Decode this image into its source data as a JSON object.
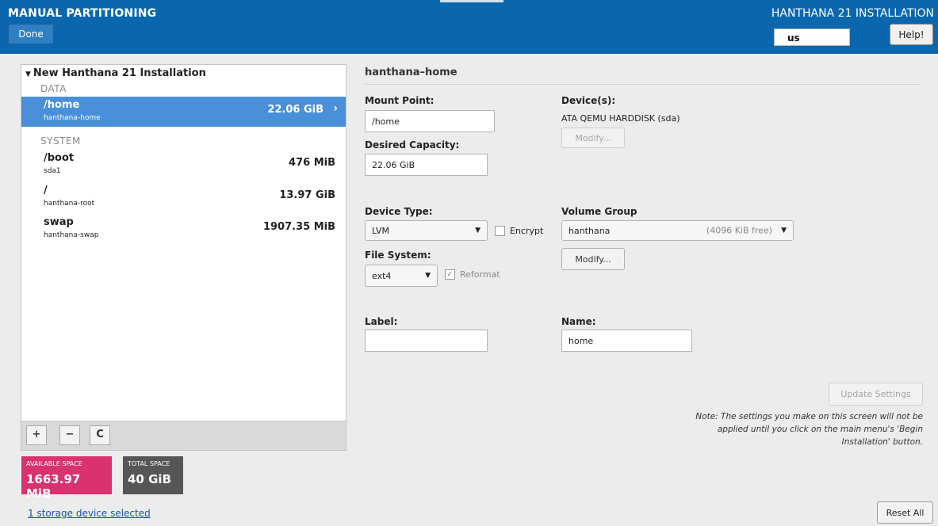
{
  "header": {
    "title": "MANUAL PARTITIONING",
    "installer_title": "HANTHANA 21 INSTALLATION",
    "done_label": "Done",
    "keyboard_layout": "us",
    "help_label": "Help!"
  },
  "tree": {
    "title": "New Hanthana 21 Installation",
    "groups": [
      {
        "label": "DATA",
        "partitions": [
          {
            "mount": "/home",
            "device": "hanthana-home",
            "size": "22.06 GiB",
            "selected": true
          }
        ]
      },
      {
        "label": "SYSTEM",
        "partitions": [
          {
            "mount": "/boot",
            "device": "sda1",
            "size": "476 MiB"
          },
          {
            "mount": "/",
            "device": "hanthana-root",
            "size": "13.97 GiB"
          },
          {
            "mount": "swap",
            "device": "hanthana-swap",
            "size": "1907.35 MiB"
          }
        ]
      }
    ],
    "toolbar": {
      "add": "+",
      "remove": "−",
      "refresh": "C"
    }
  },
  "space": {
    "available_label": "AVAILABLE SPACE",
    "available_value": "1663.97 MiB",
    "total_label": "TOTAL SPACE",
    "total_value": "40 GiB",
    "storage_link": "1 storage device selected"
  },
  "details": {
    "title": "hanthana–home",
    "mount_point_label": "Mount Point:",
    "mount_point_value": "/home",
    "desired_capacity_label": "Desired Capacity:",
    "desired_capacity_value": "22.06 GiB",
    "devices_label": "Device(s):",
    "devices_value": "ATA QEMU HARDDISK (sda)",
    "modify_label": "Modify...",
    "device_type_label": "Device Type:",
    "device_type_value": "LVM",
    "encrypt_label": "Encrypt",
    "volume_group_label": "Volume Group",
    "volume_group_value": "hanthana",
    "volume_group_free": "(4096 KiB free)",
    "vg_modify_label": "Modify...",
    "file_system_label": "File System:",
    "file_system_value": "ext4",
    "reformat_label": "Reformat",
    "reformat_checked": true,
    "label_label": "Label:",
    "label_value": "",
    "name_label": "Name:",
    "name_value": "home",
    "update_settings_label": "Update Settings",
    "note": "Note:  The settings you make on this screen will not be applied until you click on the main menu's 'Begin Installation' button."
  },
  "reset_label": "Reset All",
  "colors": {
    "header": "#0a67ae",
    "selected": "#4a90d9",
    "available": "#d9326e",
    "total": "#565656"
  }
}
